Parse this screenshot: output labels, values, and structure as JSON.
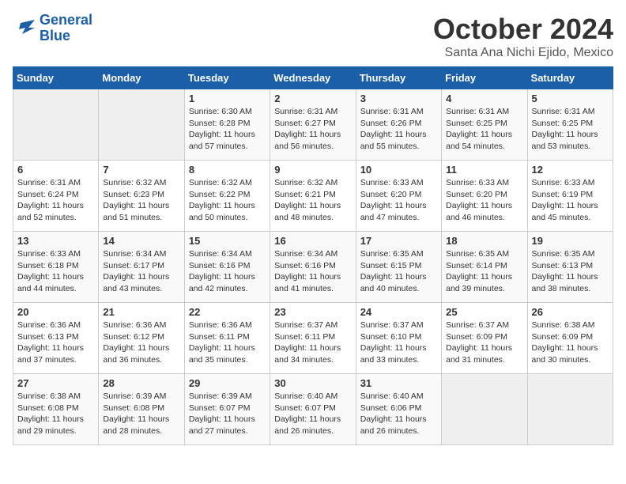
{
  "logo": {
    "line1": "General",
    "line2": "Blue"
  },
  "title": "October 2024",
  "subtitle": "Santa Ana Nichi Ejido, Mexico",
  "days_of_week": [
    "Sunday",
    "Monday",
    "Tuesday",
    "Wednesday",
    "Thursday",
    "Friday",
    "Saturday"
  ],
  "weeks": [
    [
      {
        "day": "",
        "content": ""
      },
      {
        "day": "",
        "content": ""
      },
      {
        "day": "1",
        "content": "Sunrise: 6:30 AM\nSunset: 6:28 PM\nDaylight: 11 hours\nand 57 minutes."
      },
      {
        "day": "2",
        "content": "Sunrise: 6:31 AM\nSunset: 6:27 PM\nDaylight: 11 hours\nand 56 minutes."
      },
      {
        "day": "3",
        "content": "Sunrise: 6:31 AM\nSunset: 6:26 PM\nDaylight: 11 hours\nand 55 minutes."
      },
      {
        "day": "4",
        "content": "Sunrise: 6:31 AM\nSunset: 6:25 PM\nDaylight: 11 hours\nand 54 minutes."
      },
      {
        "day": "5",
        "content": "Sunrise: 6:31 AM\nSunset: 6:25 PM\nDaylight: 11 hours\nand 53 minutes."
      }
    ],
    [
      {
        "day": "6",
        "content": "Sunrise: 6:31 AM\nSunset: 6:24 PM\nDaylight: 11 hours\nand 52 minutes."
      },
      {
        "day": "7",
        "content": "Sunrise: 6:32 AM\nSunset: 6:23 PM\nDaylight: 11 hours\nand 51 minutes."
      },
      {
        "day": "8",
        "content": "Sunrise: 6:32 AM\nSunset: 6:22 PM\nDaylight: 11 hours\nand 50 minutes."
      },
      {
        "day": "9",
        "content": "Sunrise: 6:32 AM\nSunset: 6:21 PM\nDaylight: 11 hours\nand 48 minutes."
      },
      {
        "day": "10",
        "content": "Sunrise: 6:33 AM\nSunset: 6:20 PM\nDaylight: 11 hours\nand 47 minutes."
      },
      {
        "day": "11",
        "content": "Sunrise: 6:33 AM\nSunset: 6:20 PM\nDaylight: 11 hours\nand 46 minutes."
      },
      {
        "day": "12",
        "content": "Sunrise: 6:33 AM\nSunset: 6:19 PM\nDaylight: 11 hours\nand 45 minutes."
      }
    ],
    [
      {
        "day": "13",
        "content": "Sunrise: 6:33 AM\nSunset: 6:18 PM\nDaylight: 11 hours\nand 44 minutes."
      },
      {
        "day": "14",
        "content": "Sunrise: 6:34 AM\nSunset: 6:17 PM\nDaylight: 11 hours\nand 43 minutes."
      },
      {
        "day": "15",
        "content": "Sunrise: 6:34 AM\nSunset: 6:16 PM\nDaylight: 11 hours\nand 42 minutes."
      },
      {
        "day": "16",
        "content": "Sunrise: 6:34 AM\nSunset: 6:16 PM\nDaylight: 11 hours\nand 41 minutes."
      },
      {
        "day": "17",
        "content": "Sunrise: 6:35 AM\nSunset: 6:15 PM\nDaylight: 11 hours\nand 40 minutes."
      },
      {
        "day": "18",
        "content": "Sunrise: 6:35 AM\nSunset: 6:14 PM\nDaylight: 11 hours\nand 39 minutes."
      },
      {
        "day": "19",
        "content": "Sunrise: 6:35 AM\nSunset: 6:13 PM\nDaylight: 11 hours\nand 38 minutes."
      }
    ],
    [
      {
        "day": "20",
        "content": "Sunrise: 6:36 AM\nSunset: 6:13 PM\nDaylight: 11 hours\nand 37 minutes."
      },
      {
        "day": "21",
        "content": "Sunrise: 6:36 AM\nSunset: 6:12 PM\nDaylight: 11 hours\nand 36 minutes."
      },
      {
        "day": "22",
        "content": "Sunrise: 6:36 AM\nSunset: 6:11 PM\nDaylight: 11 hours\nand 35 minutes."
      },
      {
        "day": "23",
        "content": "Sunrise: 6:37 AM\nSunset: 6:11 PM\nDaylight: 11 hours\nand 34 minutes."
      },
      {
        "day": "24",
        "content": "Sunrise: 6:37 AM\nSunset: 6:10 PM\nDaylight: 11 hours\nand 33 minutes."
      },
      {
        "day": "25",
        "content": "Sunrise: 6:37 AM\nSunset: 6:09 PM\nDaylight: 11 hours\nand 31 minutes."
      },
      {
        "day": "26",
        "content": "Sunrise: 6:38 AM\nSunset: 6:09 PM\nDaylight: 11 hours\nand 30 minutes."
      }
    ],
    [
      {
        "day": "27",
        "content": "Sunrise: 6:38 AM\nSunset: 6:08 PM\nDaylight: 11 hours\nand 29 minutes."
      },
      {
        "day": "28",
        "content": "Sunrise: 6:39 AM\nSunset: 6:08 PM\nDaylight: 11 hours\nand 28 minutes."
      },
      {
        "day": "29",
        "content": "Sunrise: 6:39 AM\nSunset: 6:07 PM\nDaylight: 11 hours\nand 27 minutes."
      },
      {
        "day": "30",
        "content": "Sunrise: 6:40 AM\nSunset: 6:07 PM\nDaylight: 11 hours\nand 26 minutes."
      },
      {
        "day": "31",
        "content": "Sunrise: 6:40 AM\nSunset: 6:06 PM\nDaylight: 11 hours\nand 26 minutes."
      },
      {
        "day": "",
        "content": ""
      },
      {
        "day": "",
        "content": ""
      }
    ]
  ]
}
